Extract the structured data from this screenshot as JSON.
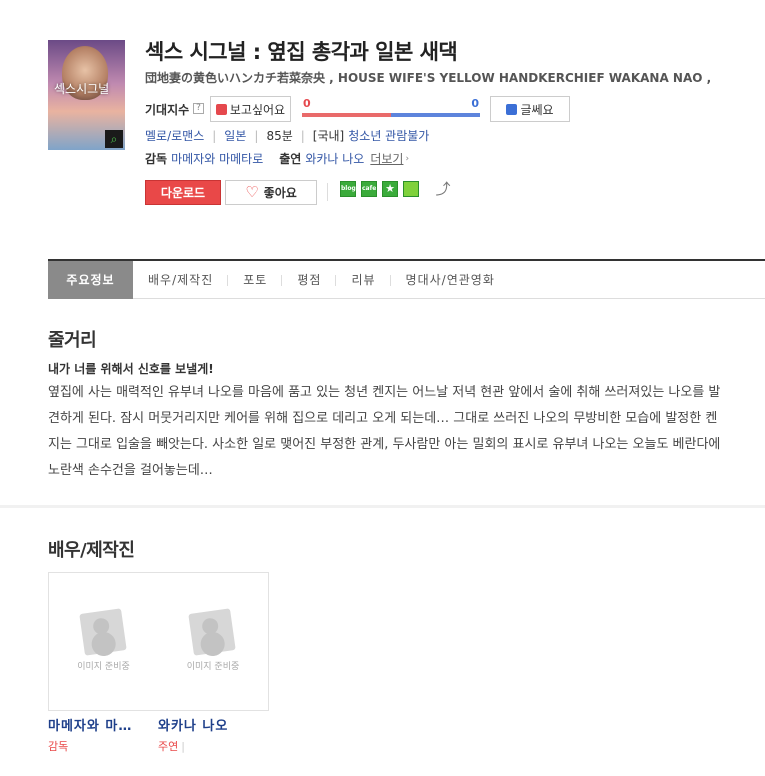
{
  "movie": {
    "title": "섹스 시그널 : 옆집 총각과 일본 새댁",
    "subtitle": "団地妻の黄色いハンカチ若菜奈央 , HOUSE WIFE'S YELLOW HANDKERCHIEF WAKANA NAO ,",
    "poster_text": "섹스시그널",
    "poster_zoom_icon": "magnifier-icon"
  },
  "expectation": {
    "label": "기대지수",
    "help_mark": "?",
    "want_label": "보고싶어요",
    "want_count": "0",
    "nope_label": "글쎄요",
    "nope_count": "0",
    "want_share": 0.5,
    "colors": {
      "want": "#e5484d",
      "nope": "#3b6fd6"
    }
  },
  "meta": {
    "genre": "멜로/로맨스",
    "country": "일본",
    "runtime": "85분",
    "rating_prefix": "[국내]",
    "rating": "청소년 관람불가",
    "director_label": "감독",
    "director": "마메자와 마메타로",
    "cast_label": "출연",
    "cast": "와카나 나오",
    "more_label": "더보기",
    "more_arrow": "›"
  },
  "actions": {
    "download_label": "다운로드",
    "like_label": "좋아요",
    "share_icons": [
      "blog",
      "cafe",
      "★",
      ""
    ]
  },
  "tabs": [
    "주요정보",
    "배우/제작진",
    "포토",
    "평점",
    "리뷰",
    "명대사/연관영화"
  ],
  "plot": {
    "section_title": "줄거리",
    "headline": "내가 너를 위해서 신호를 보낼게!",
    "body": "옆집에 사는 매력적인 유부녀 나오를 마음에 품고 있는 청년 켄지는 어느날 저녁 현관 앞에서 술에 취해 쓰러져있는 나오를 발견하게 된다. 잠시 머뭇거리지만 케어를 위해 집으로 데리고 오게 되는데… 그대로 쓰러진 나오의 무방비한 모습에 발정한 켄지는 그대로 입술을 빼앗는다. 사소한 일로 맺어진 부정한 관계, 두사람만 아는 밀회의 표시로 유부녀 나오는 오늘도 베란다에 노란색 손수건을 걸어놓는데…"
  },
  "crew": {
    "section_title": "배우/제작진",
    "placeholder_text": "이미지 준비중",
    "people": [
      {
        "name": "마메자와 마…",
        "role": "감독"
      },
      {
        "name": "와카나 나오",
        "role": "주연"
      }
    ]
  },
  "colors": {
    "accent_red": "#e94848",
    "link_blue": "#3457a6"
  }
}
